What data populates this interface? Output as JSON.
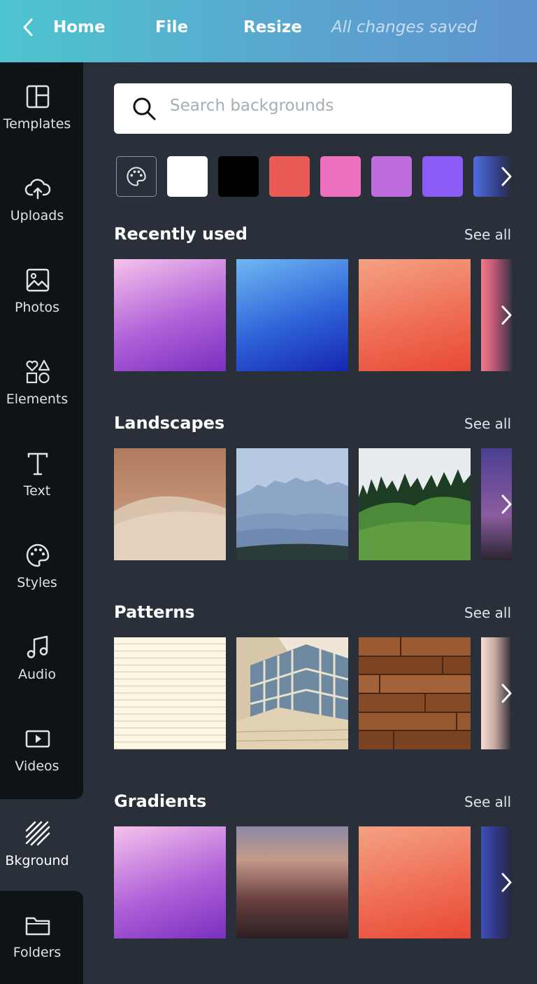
{
  "topbar": {
    "home_label": "Home",
    "file_label": "File",
    "resize_label": "Resize",
    "status": "All changes saved"
  },
  "sidebar": {
    "items": [
      {
        "label": "Templates",
        "icon": "templates-icon"
      },
      {
        "label": "Uploads",
        "icon": "cloud-upload-icon"
      },
      {
        "label": "Photos",
        "icon": "image-icon"
      },
      {
        "label": "Elements",
        "icon": "shapes-icon"
      },
      {
        "label": "Text",
        "icon": "text-icon"
      },
      {
        "label": "Styles",
        "icon": "palette-icon"
      },
      {
        "label": "Audio",
        "icon": "music-note-icon"
      },
      {
        "label": "Videos",
        "icon": "video-icon"
      },
      {
        "label": "Bkground",
        "icon": "stripes-icon",
        "active": true
      },
      {
        "label": "Folders",
        "icon": "folder-icon"
      }
    ]
  },
  "search": {
    "placeholder": "Search backgrounds"
  },
  "colors": {
    "swatches": [
      "#ffffff",
      "#000000",
      "#ea5a57",
      "#ee6fc0",
      "#bf6cdc",
      "#8b5cf6",
      "#4f6de0"
    ]
  },
  "sections": [
    {
      "title": "Recently used",
      "see_all": "See all"
    },
    {
      "title": "Landscapes",
      "see_all": "See all"
    },
    {
      "title": "Patterns",
      "see_all": "See all"
    },
    {
      "title": "Gradients",
      "see_all": "See all"
    }
  ]
}
